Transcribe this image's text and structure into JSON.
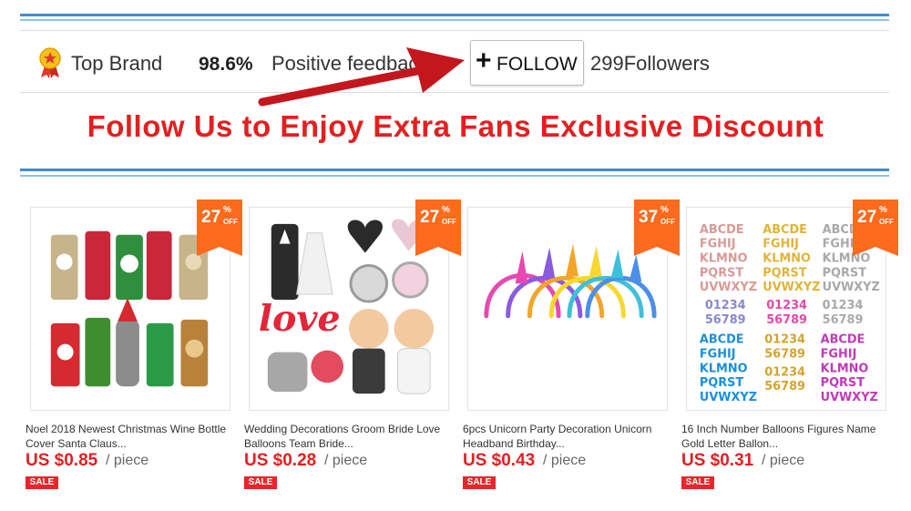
{
  "store": {
    "badge_text": "Top Brand",
    "score": "98.6%",
    "feedback_text": "Positive feedback",
    "follow_plus": "+",
    "follow_label": "FOLLOW",
    "followers": "299Followers"
  },
  "promo": {
    "text": "Follow Us to Enjoy Extra Fans Exclusive Discount"
  },
  "colors": {
    "accent_red": "#e41f1f",
    "discount_orange": "#fb6a1d",
    "line_blue": "#3c8fd6"
  },
  "products": [
    {
      "title": "Noel 2018 Newest Christmas Wine Bottle Cover Santa Claus...",
      "price": "US $0.85",
      "unit": "/ piece",
      "discount": "27",
      "badge": "SALE",
      "image": "christmas-wine-bottle-covers"
    },
    {
      "title": "Wedding Decorations Groom Bride Love Balloons Team Bride...",
      "price": "US $0.28",
      "unit": "/ piece",
      "discount": "27",
      "badge": "SALE",
      "image": "wedding-balloons"
    },
    {
      "title": "6pcs Unicorn Party Decoration Unicorn Headband Birthday...",
      "price": "US $0.43",
      "unit": "/ piece",
      "discount": "37",
      "badge": "SALE",
      "image": "unicorn-headbands"
    },
    {
      "title": "16 Inch Number Balloons Figures Name Gold Letter Ballon...",
      "price": "US $0.31",
      "unit": "/ piece",
      "discount": "27",
      "badge": "SALE",
      "image": "letter-number-balloons"
    }
  ],
  "labels": {
    "pct": "%",
    "off": "OFF"
  },
  "balloons": {
    "rows1": [
      "ABCDE",
      "FGHIJ",
      "KLMNO",
      "PQRST",
      "UVWXYZ"
    ],
    "nums1": "01234",
    "nums2": "56789"
  }
}
